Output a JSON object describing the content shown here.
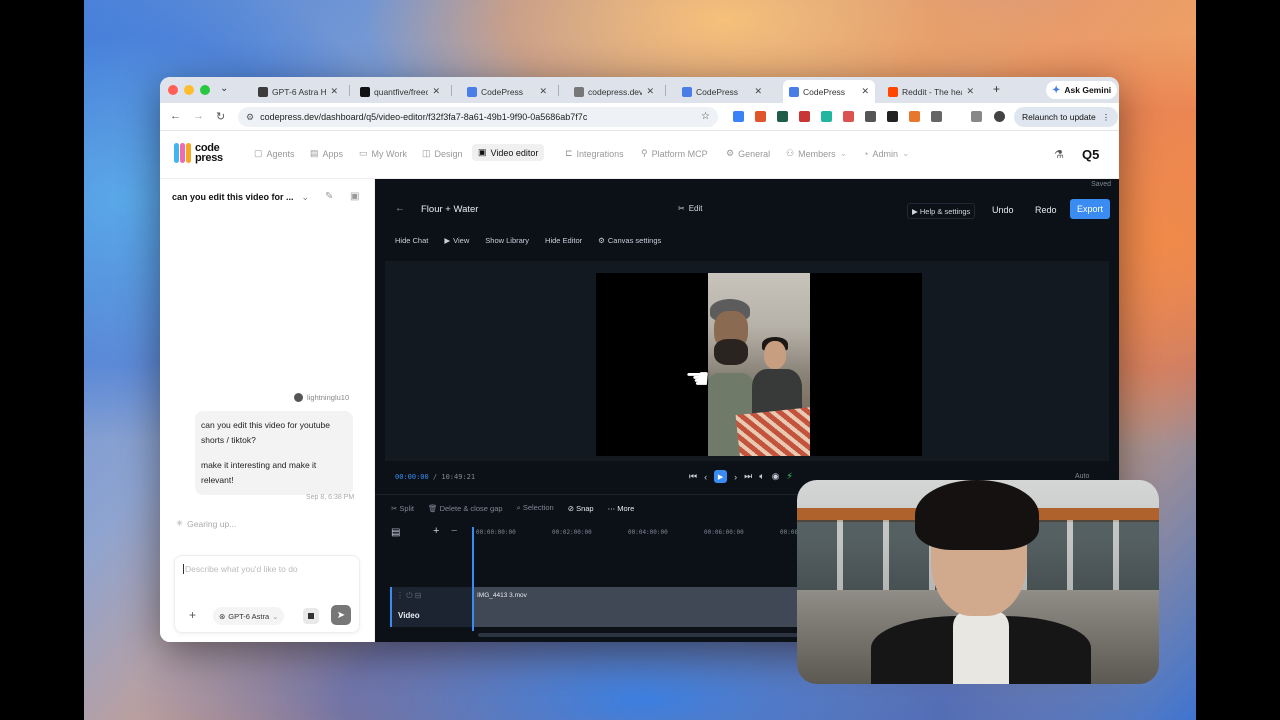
{
  "browser": {
    "tabs": [
      {
        "title": "GPT-6 Astra Ha...",
        "color": "#3c3c3c"
      },
      {
        "title": "quantfive/freecu...",
        "color": "#111111"
      },
      {
        "title": "CodePress",
        "color": "#4a7de8"
      },
      {
        "title": "codepress.dev",
        "color": "#777777"
      },
      {
        "title": "CodePress",
        "color": "#4a7de8"
      },
      {
        "title": "CodePress",
        "color": "#4a7de8"
      },
      {
        "title": "Reddit - The hea...",
        "color": "#ff4500"
      }
    ],
    "new_tab": "+",
    "ask_gemini": "Ask Gemini",
    "url": "codepress.dev/dashboard/q5/video-editor/f32f3fa7-8a61-49b1-9f90-0a5686ab7f7c",
    "relaunch": "Relaunch to update"
  },
  "app": {
    "logo": {
      "line1": "code",
      "line2": "press"
    },
    "nav": [
      {
        "label": "Agents",
        "icon": "chat-icon"
      },
      {
        "label": "Apps",
        "icon": "doc-icon"
      },
      {
        "label": "My Work",
        "icon": "folder-icon"
      },
      {
        "label": "Design",
        "icon": "design-icon"
      },
      {
        "label": "Video editor",
        "icon": "film-icon"
      },
      {
        "label": "Integrations",
        "icon": "plug-icon"
      },
      {
        "label": "Platform MCP",
        "icon": "key-icon"
      },
      {
        "label": "General",
        "icon": "gear-icon"
      },
      {
        "label": "Members",
        "icon": "users-icon"
      },
      {
        "label": "Admin",
        "icon": "shield-icon"
      }
    ],
    "org": "Q5"
  },
  "chat": {
    "title": "can you edit this video for ...",
    "user": "lightninglu10",
    "message": [
      "can you edit this video for youtube shorts / tiktok?",
      "make it interesting and make it relevant!"
    ],
    "time": "Sep 8, 6:38 PM",
    "status": "Gearing up...",
    "input_placeholder": "Describe what you'd like to do",
    "model": "GPT-6 Astra"
  },
  "editor": {
    "saved": "Saved",
    "project_title": "Flour + Water",
    "edit": "Edit",
    "help": "Help & settings",
    "undo": "Undo",
    "redo": "Redo",
    "export": "Export",
    "toolbar": [
      "Hide Chat",
      "View",
      "Show Library",
      "Hide Editor",
      "Canvas settings"
    ],
    "current_time": "00:00:00",
    "total_time": "10:49:21",
    "auto": "Auto",
    "timeline_tools": {
      "split": "Split",
      "delete": "Delete & close gap",
      "selection": "Selection",
      "snap": "Snap",
      "more": "More"
    },
    "ruler": [
      "00:00:00:00",
      "00:02:00:00",
      "00:04:00:00",
      "00:06:00:00",
      "00:08:00:00"
    ],
    "track": {
      "label": "Video",
      "clip": "IMG_4413 3.mov"
    }
  }
}
